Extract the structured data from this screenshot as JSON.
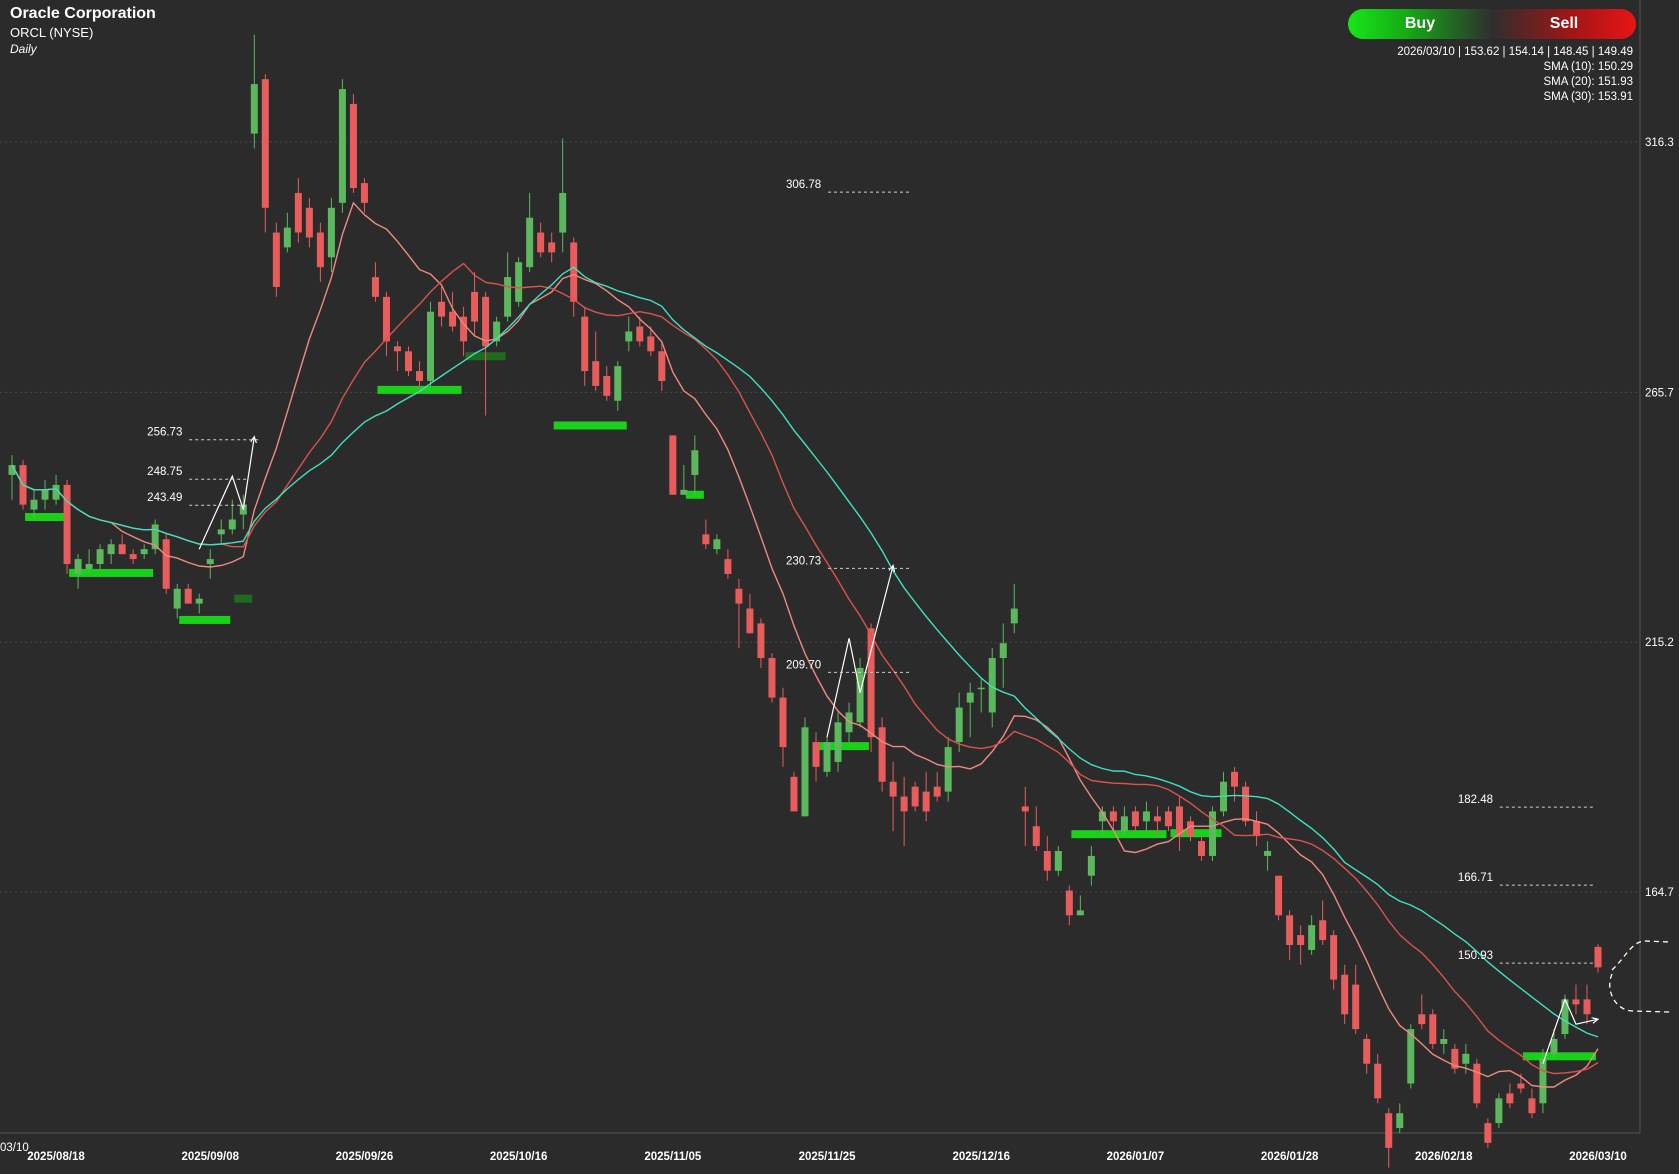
{
  "header": {
    "company": "Oracle Corporation",
    "ticker": "ORCL (NYSE)",
    "interval": "Daily"
  },
  "signal": {
    "buy_label": "Buy",
    "sell_label": "Sell",
    "buy_color": "#19e619",
    "sell_color": "#e81515"
  },
  "info_panel": {
    "ohlc": "2026/03/10 | 153.62 | 154.14 | 148.45 | 149.49",
    "sma10": "SMA (10): 150.29",
    "sma20": "SMA (20): 151.93",
    "sma30": "SMA (30): 153.91"
  },
  "colors": {
    "background": "#2b2b2b",
    "up": "#5cb85c",
    "down": "#e85c5c",
    "sma10": "#f08a80",
    "sma20": "#d9534f",
    "sma30": "#40e0c0",
    "support": "#19d119",
    "support_dim": "#1f6a1f"
  },
  "chart_data": {
    "type": "candlestick",
    "y_ticks": [
      164.7,
      215.2,
      265.7,
      316.3
    ],
    "ylim": [
      116,
      345
    ],
    "x_ticks": [
      "2025/08/18",
      "2025/09/08",
      "2025/09/26",
      "2025/10/16",
      "2025/11/05",
      "2025/11/25",
      "2025/12/16",
      "2026/01/07",
      "2026/01/28",
      "2026/02/18",
      "2026/03/10"
    ],
    "x_edge_label": "03/10",
    "candles": [
      {
        "date": "2025/08/12",
        "o": 249,
        "h": 253,
        "l": 244,
        "c": 251
      },
      {
        "date": "2025/08/13",
        "o": 251,
        "h": 252,
        "l": 242,
        "c": 243
      },
      {
        "date": "2025/08/14",
        "o": 242,
        "h": 246,
        "l": 240,
        "c": 244
      },
      {
        "date": "2025/08/15",
        "o": 244,
        "h": 248,
        "l": 242,
        "c": 246
      },
      {
        "date": "2025/08/18",
        "o": 244,
        "h": 249,
        "l": 243,
        "c": 247
      },
      {
        "date": "2025/08/19",
        "o": 247,
        "h": 248,
        "l": 229,
        "c": 231
      },
      {
        "date": "2025/08/20",
        "o": 229,
        "h": 233,
        "l": 226,
        "c": 232
      },
      {
        "date": "2025/08/21",
        "o": 230,
        "h": 234,
        "l": 229,
        "c": 231
      },
      {
        "date": "2025/08/22",
        "o": 231,
        "h": 235,
        "l": 230,
        "c": 234
      },
      {
        "date": "2025/08/25",
        "o": 233,
        "h": 236,
        "l": 231,
        "c": 235
      },
      {
        "date": "2025/08/26",
        "o": 235,
        "h": 237,
        "l": 233,
        "c": 233
      },
      {
        "date": "2025/08/27",
        "o": 233,
        "h": 234,
        "l": 231,
        "c": 232
      },
      {
        "date": "2025/08/28",
        "o": 233,
        "h": 235,
        "l": 232,
        "c": 234
      },
      {
        "date": "2025/08/29",
        "o": 234,
        "h": 240,
        "l": 233,
        "c": 239
      },
      {
        "date": "2025/09/02",
        "o": 236,
        "h": 237,
        "l": 225,
        "c": 226
      },
      {
        "date": "2025/09/03",
        "o": 222,
        "h": 227,
        "l": 220,
        "c": 226
      },
      {
        "date": "2025/09/04",
        "o": 226,
        "h": 227,
        "l": 223,
        "c": 223
      },
      {
        "date": "2025/09/05",
        "o": 223,
        "h": 225,
        "l": 221,
        "c": 224
      },
      {
        "date": "2025/09/08",
        "o": 231,
        "h": 234,
        "l": 228,
        "c": 232
      },
      {
        "date": "2025/09/09",
        "o": 237,
        "h": 240,
        "l": 235,
        "c": 238
      },
      {
        "date": "2025/09/10",
        "o": 238,
        "h": 244,
        "l": 237,
        "c": 240
      },
      {
        "date": "2025/09/11",
        "o": 241,
        "h": 245,
        "l": 238,
        "c": 243
      },
      {
        "date": "2025/09/12",
        "o": 318,
        "h": 338,
        "l": 315,
        "c": 328
      },
      {
        "date": "2025/09/15",
        "o": 329,
        "h": 330,
        "l": 298,
        "c": 303
      },
      {
        "date": "2025/09/16",
        "o": 298,
        "h": 300,
        "l": 285,
        "c": 287
      },
      {
        "date": "2025/09/17",
        "o": 295,
        "h": 302,
        "l": 294,
        "c": 299
      },
      {
        "date": "2025/09/18",
        "o": 306,
        "h": 309,
        "l": 296,
        "c": 298
      },
      {
        "date": "2025/09/19",
        "o": 303,
        "h": 305,
        "l": 295,
        "c": 297
      },
      {
        "date": "2025/09/22",
        "o": 298,
        "h": 300,
        "l": 288,
        "c": 291
      },
      {
        "date": "2025/09/23",
        "o": 293,
        "h": 305,
        "l": 290,
        "c": 303
      },
      {
        "date": "2025/09/24",
        "o": 304,
        "h": 329,
        "l": 302,
        "c": 327
      },
      {
        "date": "2025/09/25",
        "o": 324,
        "h": 326,
        "l": 306,
        "c": 307
      },
      {
        "date": "2025/09/26",
        "o": 308,
        "h": 309,
        "l": 302,
        "c": 304
      },
      {
        "date": "2025/09/29",
        "o": 289,
        "h": 292,
        "l": 284,
        "c": 285
      },
      {
        "date": "2025/09/30",
        "o": 285,
        "h": 286,
        "l": 273,
        "c": 276
      },
      {
        "date": "2025/10/01",
        "o": 275,
        "h": 276,
        "l": 270,
        "c": 274
      },
      {
        "date": "2025/10/02",
        "o": 274,
        "h": 275,
        "l": 269,
        "c": 270
      },
      {
        "date": "2025/10/03",
        "o": 270,
        "h": 272,
        "l": 266,
        "c": 268
      },
      {
        "date": "2025/10/06",
        "o": 268,
        "h": 284,
        "l": 267,
        "c": 282
      },
      {
        "date": "2025/10/07",
        "o": 284,
        "h": 287,
        "l": 279,
        "c": 281
      },
      {
        "date": "2025/10/08",
        "o": 282,
        "h": 286,
        "l": 278,
        "c": 279
      },
      {
        "date": "2025/10/09",
        "o": 281,
        "h": 283,
        "l": 273,
        "c": 276
      },
      {
        "date": "2025/10/10",
        "o": 286,
        "h": 290,
        "l": 277,
        "c": 280
      },
      {
        "date": "2025/10/13",
        "o": 285,
        "h": 286,
        "l": 261,
        "c": 275
      },
      {
        "date": "2025/10/14",
        "o": 276,
        "h": 281,
        "l": 275,
        "c": 280
      },
      {
        "date": "2025/10/15",
        "o": 281,
        "h": 294,
        "l": 280,
        "c": 289
      },
      {
        "date": "2025/10/16",
        "o": 284,
        "h": 293,
        "l": 283,
        "c": 292
      },
      {
        "date": "2025/10/17",
        "o": 291,
        "h": 306,
        "l": 290,
        "c": 301
      },
      {
        "date": "2025/10/20",
        "o": 298,
        "h": 300,
        "l": 293,
        "c": 294
      },
      {
        "date": "2025/10/21",
        "o": 296,
        "h": 298,
        "l": 292,
        "c": 294
      },
      {
        "date": "2025/10/22",
        "o": 298,
        "h": 317,
        "l": 294,
        "c": 306
      },
      {
        "date": "2025/10/23",
        "o": 296,
        "h": 297,
        "l": 281,
        "c": 284
      },
      {
        "date": "2025/10/24",
        "o": 281,
        "h": 283,
        "l": 267,
        "c": 270
      },
      {
        "date": "2025/10/27",
        "o": 272,
        "h": 278,
        "l": 266,
        "c": 267
      },
      {
        "date": "2025/10/28",
        "o": 269,
        "h": 271,
        "l": 264,
        "c": 265
      },
      {
        "date": "2025/10/29",
        "o": 264,
        "h": 272,
        "l": 262,
        "c": 271
      },
      {
        "date": "2025/10/30",
        "o": 276,
        "h": 281,
        "l": 274,
        "c": 278
      },
      {
        "date": "2025/10/31",
        "o": 279,
        "h": 281,
        "l": 275,
        "c": 276
      },
      {
        "date": "2025/11/03",
        "o": 277,
        "h": 279,
        "l": 273,
        "c": 274
      },
      {
        "date": "2025/11/04",
        "o": 274,
        "h": 276,
        "l": 266,
        "c": 268
      },
      {
        "date": "2025/11/05",
        "o": 257,
        "h": 257,
        "l": 245,
        "c": 245
      },
      {
        "date": "2025/11/06",
        "o": 245,
        "h": 251,
        "l": 245,
        "c": 246
      },
      {
        "date": "2025/11/07",
        "o": 249,
        "h": 257,
        "l": 245,
        "c": 254
      },
      {
        "date": "2025/11/10",
        "o": 237,
        "h": 240,
        "l": 234,
        "c": 235
      },
      {
        "date": "2025/11/11",
        "o": 234,
        "h": 237,
        "l": 233,
        "c": 236
      },
      {
        "date": "2025/11/12",
        "o": 232,
        "h": 234,
        "l": 228,
        "c": 229
      },
      {
        "date": "2025/11/13",
        "o": 226,
        "h": 228,
        "l": 214,
        "c": 223
      },
      {
        "date": "2025/11/14",
        "o": 222,
        "h": 225,
        "l": 217,
        "c": 217
      },
      {
        "date": "2025/11/17",
        "o": 219,
        "h": 220,
        "l": 210,
        "c": 212
      },
      {
        "date": "2025/11/18",
        "o": 212,
        "h": 213,
        "l": 203,
        "c": 204
      },
      {
        "date": "2025/11/19",
        "o": 204,
        "h": 206,
        "l": 190,
        "c": 194
      },
      {
        "date": "2025/11/20",
        "o": 188,
        "h": 189,
        "l": 181,
        "c": 181
      },
      {
        "date": "2025/11/21",
        "o": 180,
        "h": 200,
        "l": 180,
        "c": 198
      },
      {
        "date": "2025/11/24",
        "o": 195,
        "h": 197,
        "l": 187,
        "c": 190
      },
      {
        "date": "2025/11/25",
        "o": 189,
        "h": 196,
        "l": 188,
        "c": 195
      },
      {
        "date": "2025/11/26",
        "o": 191,
        "h": 201,
        "l": 189,
        "c": 199
      },
      {
        "date": "2025/11/28",
        "o": 197,
        "h": 203,
        "l": 195,
        "c": 201
      },
      {
        "date": "2025/12/01",
        "o": 199,
        "h": 212,
        "l": 198,
        "c": 210
      },
      {
        "date": "2025/12/02",
        "o": 218,
        "h": 219,
        "l": 193,
        "c": 196
      },
      {
        "date": "2025/12/03",
        "o": 198,
        "h": 200,
        "l": 185,
        "c": 187
      },
      {
        "date": "2025/12/04",
        "o": 187,
        "h": 191,
        "l": 177,
        "c": 184
      },
      {
        "date": "2025/12/05",
        "o": 184,
        "h": 188,
        "l": 174,
        "c": 181
      },
      {
        "date": "2025/12/08",
        "o": 186,
        "h": 187,
        "l": 181,
        "c": 182
      },
      {
        "date": "2025/12/09",
        "o": 185,
        "h": 189,
        "l": 179,
        "c": 181
      },
      {
        "date": "2025/12/10",
        "o": 186,
        "h": 189,
        "l": 183,
        "c": 184
      },
      {
        "date": "2025/12/11",
        "o": 185,
        "h": 196,
        "l": 183,
        "c": 194
      },
      {
        "date": "2025/12/12",
        "o": 195,
        "h": 205,
        "l": 193,
        "c": 202
      },
      {
        "date": "2025/12/15",
        "o": 203,
        "h": 207,
        "l": 196,
        "c": 205
      },
      {
        "date": "2025/12/16",
        "o": 206,
        "h": 208,
        "l": 201,
        "c": 206
      },
      {
        "date": "2025/12/17",
        "o": 201,
        "h": 214,
        "l": 198,
        "c": 212
      },
      {
        "date": "2025/12/18",
        "o": 212,
        "h": 219,
        "l": 206,
        "c": 215
      },
      {
        "date": "2025/12/19",
        "o": 219,
        "h": 227,
        "l": 217,
        "c": 222
      },
      {
        "date": "2025/12/22",
        "o": 182,
        "h": 186,
        "l": 174,
        "c": 181
      },
      {
        "date": "2025/12/23",
        "o": 178,
        "h": 182,
        "l": 173,
        "c": 174
      },
      {
        "date": "2025/12/24",
        "o": 173,
        "h": 176,
        "l": 167,
        "c": 169
      },
      {
        "date": "2025/12/26",
        "o": 169,
        "h": 174,
        "l": 168,
        "c": 173
      },
      {
        "date": "2025/12/29",
        "o": 165,
        "h": 166,
        "l": 158,
        "c": 160
      },
      {
        "date": "2025/12/30",
        "o": 160,
        "h": 164,
        "l": 160,
        "c": 161
      },
      {
        "date": "2025/12/31",
        "o": 168,
        "h": 174,
        "l": 166,
        "c": 172
      },
      {
        "date": "2026/01/02",
        "o": 179,
        "h": 182,
        "l": 176,
        "c": 181
      },
      {
        "date": "2026/01/05",
        "o": 181,
        "h": 182,
        "l": 177,
        "c": 179
      },
      {
        "date": "2026/01/06",
        "o": 177,
        "h": 182,
        "l": 176,
        "c": 180
      },
      {
        "date": "2026/01/07",
        "o": 181,
        "h": 182,
        "l": 177,
        "c": 178
      },
      {
        "date": "2026/01/08",
        "o": 179,
        "h": 183,
        "l": 177,
        "c": 181
      },
      {
        "date": "2026/01/09",
        "o": 180,
        "h": 182,
        "l": 176,
        "c": 179
      },
      {
        "date": "2026/01/12",
        "o": 181,
        "h": 182,
        "l": 177,
        "c": 178
      },
      {
        "date": "2026/01/13",
        "o": 182,
        "h": 184,
        "l": 173,
        "c": 176
      },
      {
        "date": "2026/01/14",
        "o": 179,
        "h": 180,
        "l": 175,
        "c": 176
      },
      {
        "date": "2026/01/15",
        "o": 175,
        "h": 176,
        "l": 171,
        "c": 172
      },
      {
        "date": "2026/01/16",
        "o": 172,
        "h": 182,
        "l": 171,
        "c": 181
      },
      {
        "date": "2026/01/20",
        "o": 181,
        "h": 189,
        "l": 180,
        "c": 187
      },
      {
        "date": "2026/01/21",
        "o": 189,
        "h": 190,
        "l": 183,
        "c": 186
      },
      {
        "date": "2026/01/22",
        "o": 186,
        "h": 187,
        "l": 178,
        "c": 179
      },
      {
        "date": "2026/01/23",
        "o": 179,
        "h": 181,
        "l": 174,
        "c": 176
      },
      {
        "date": "2026/01/26",
        "o": 172,
        "h": 175,
        "l": 169,
        "c": 173
      },
      {
        "date": "2026/01/27",
        "o": 168,
        "h": 168,
        "l": 159,
        "c": 160
      },
      {
        "date": "2026/01/28",
        "o": 160,
        "h": 161,
        "l": 151,
        "c": 154
      },
      {
        "date": "2026/01/29",
        "o": 156,
        "h": 158,
        "l": 150,
        "c": 154
      },
      {
        "date": "2026/01/30",
        "o": 153,
        "h": 160,
        "l": 152,
        "c": 158
      },
      {
        "date": "2026/02/02",
        "o": 159,
        "h": 163,
        "l": 154,
        "c": 155
      },
      {
        "date": "2026/02/03",
        "o": 156,
        "h": 157,
        "l": 145,
        "c": 147
      },
      {
        "date": "2026/02/04",
        "o": 148,
        "h": 150,
        "l": 138,
        "c": 140
      },
      {
        "date": "2026/02/05",
        "o": 146,
        "h": 150,
        "l": 136,
        "c": 137
      },
      {
        "date": "2026/02/06",
        "o": 135,
        "h": 136,
        "l": 128,
        "c": 130
      },
      {
        "date": "2026/02/09",
        "o": 130,
        "h": 132,
        "l": 122,
        "c": 123
      },
      {
        "date": "2026/02/10",
        "o": 120,
        "h": 121,
        "l": 109,
        "c": 113
      },
      {
        "date": "2026/02/11",
        "o": 117,
        "h": 122,
        "l": 116,
        "c": 120
      },
      {
        "date": "2026/02/12",
        "o": 126,
        "h": 138,
        "l": 125,
        "c": 137
      },
      {
        "date": "2026/02/13",
        "o": 140,
        "h": 144,
        "l": 137,
        "c": 138
      },
      {
        "date": "2026/02/17",
        "o": 140,
        "h": 141,
        "l": 133,
        "c": 134
      },
      {
        "date": "2026/02/18",
        "o": 134,
        "h": 137,
        "l": 132,
        "c": 135
      },
      {
        "date": "2026/02/19",
        "o": 133,
        "h": 134,
        "l": 128,
        "c": 129
      },
      {
        "date": "2026/02/20",
        "o": 130,
        "h": 134,
        "l": 128,
        "c": 132
      },
      {
        "date": "2026/02/23",
        "o": 130,
        "h": 131,
        "l": 121,
        "c": 122
      },
      {
        "date": "2026/02/24",
        "o": 118,
        "h": 119,
        "l": 113,
        "c": 114
      },
      {
        "date": "2026/02/25",
        "o": 118,
        "h": 124,
        "l": 117,
        "c": 123
      },
      {
        "date": "2026/02/26",
        "o": 124,
        "h": 126,
        "l": 121,
        "c": 122
      },
      {
        "date": "2026/02/27",
        "o": 126,
        "h": 128,
        "l": 124,
        "c": 125
      },
      {
        "date": "2026/03/02",
        "o": 123,
        "h": 125,
        "l": 119,
        "c": 120
      },
      {
        "date": "2026/03/03",
        "o": 122,
        "h": 133,
        "l": 120,
        "c": 131
      },
      {
        "date": "2026/03/04",
        "o": 132,
        "h": 137,
        "l": 131,
        "c": 135
      },
      {
        "date": "2026/03/05",
        "o": 136,
        "h": 144,
        "l": 135,
        "c": 143
      },
      {
        "date": "2026/03/06",
        "o": 143,
        "h": 146,
        "l": 140,
        "c": 142
      },
      {
        "date": "2026/03/09",
        "o": 143,
        "h": 146,
        "l": 138,
        "c": 140
      },
      {
        "date": "2026/03/10",
        "o": 153.62,
        "h": 154.14,
        "l": 148.45,
        "c": 149.49
      }
    ],
    "price_labels": [
      {
        "text": "256.73",
        "value": 256.73
      },
      {
        "text": "248.75",
        "value": 248.75
      },
      {
        "text": "243.49",
        "value": 243.49
      },
      {
        "text": "306.78",
        "value": 306.78
      },
      {
        "text": "230.73",
        "value": 230.73
      },
      {
        "text": "209.70",
        "value": 209.7
      },
      {
        "text": "182.48",
        "value": 182.48
      },
      {
        "text": "166.71",
        "value": 166.71
      },
      {
        "text": "150.93",
        "value": 150.93
      }
    ]
  }
}
